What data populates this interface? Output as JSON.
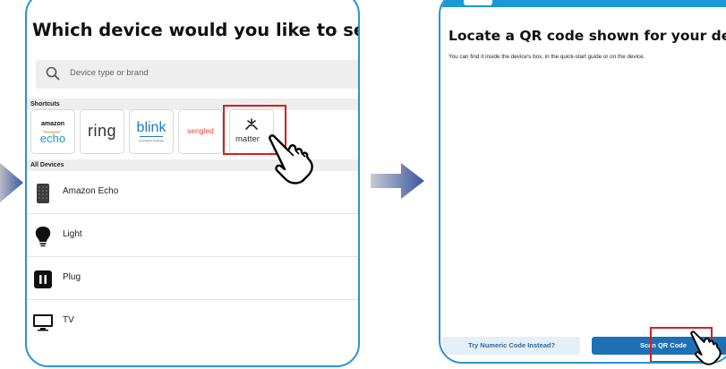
{
  "colors": {
    "frame": "#2a93d5",
    "highlight": "#d32020",
    "accent": "#1f6fb5",
    "arrow": "#3a55a0"
  },
  "left_screen": {
    "title": "Which device would you like to set up?",
    "search": {
      "placeholder": "Device type or brand",
      "icon": "search-icon"
    },
    "shortcuts_header": "Shortcuts",
    "shortcuts": [
      {
        "top": "amazon",
        "bottom": "echo"
      },
      {
        "label": "ring"
      },
      {
        "label": "blink",
        "sub": "an amazon company"
      },
      {
        "label": "sengled"
      },
      {
        "label": "matter"
      }
    ],
    "all_devices_header": "All Devices",
    "devices": [
      {
        "label": "Amazon Echo",
        "icon": "echo-speaker-icon"
      },
      {
        "label": "Light",
        "icon": "lightbulb-icon"
      },
      {
        "label": "Plug",
        "icon": "plug-icon"
      },
      {
        "label": "TV",
        "icon": "tv-icon"
      }
    ]
  },
  "right_screen": {
    "title": "Locate a QR code shown for your device",
    "subtitle": "You can find it inside the device's box, in the quick-start guide or on the device.",
    "numeric_button": "Try Numeric Code Instead?",
    "scan_button": "Scan QR Code"
  }
}
